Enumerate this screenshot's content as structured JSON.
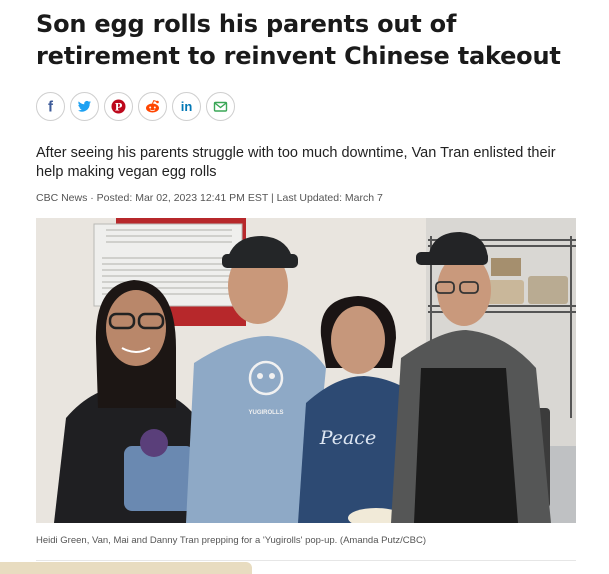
{
  "article": {
    "headline": "Son egg rolls his parents out of retirement to reinvent Chinese takeout",
    "deck": "After seeing his parents struggle with too much downtime, Van Tran enlisted their help making vegan egg rolls",
    "byline": "CBC News · Posted: Mar 02, 2023 12:41 PM EST | Last Updated: March 7",
    "photo_caption": "Heidi Green, Van, Mai and Danny Tran prepping for a 'Yugirolls' pop-up. (Amanda Putz/CBC)"
  },
  "share": [
    {
      "icon": "facebook-icon",
      "glyph": "f",
      "color": "#3b5998"
    },
    {
      "icon": "twitter-icon",
      "glyph": "",
      "color": "#1da1f2"
    },
    {
      "icon": "pinterest-icon",
      "glyph": "P",
      "color": "#bd081c"
    },
    {
      "icon": "reddit-icon",
      "glyph": "",
      "color": "#ff4500"
    },
    {
      "icon": "linkedin-icon",
      "glyph": "in",
      "color": "#0077b5"
    },
    {
      "icon": "email-icon",
      "glyph": "",
      "color": "#3aa757"
    }
  ],
  "photo": {
    "shirt_text_logo": "YUGIROLLS",
    "shirt_text_peace": "Peace"
  }
}
